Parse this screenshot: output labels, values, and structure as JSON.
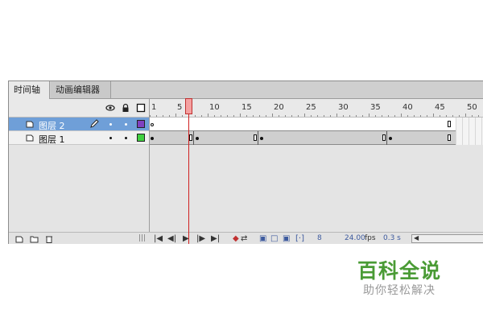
{
  "tabs": [
    {
      "label": "时间轴",
      "active": true
    },
    {
      "label": "动画编辑器",
      "active": false
    }
  ],
  "header_icons": [
    "eye-icon",
    "lock-icon",
    "outline-icon"
  ],
  "ruler": {
    "labels": [
      "1",
      "5",
      "10",
      "15",
      "20",
      "25",
      "30",
      "35",
      "40",
      "45",
      "50"
    ]
  },
  "layers": [
    {
      "name": "图层 2",
      "selected": true,
      "color": "#8040c0",
      "pencil": true
    },
    {
      "name": "图层 1",
      "selected": false,
      "color": "#40d040",
      "pencil": false
    }
  ],
  "timeline": {
    "current_frame": "8",
    "fps_value": "24.00",
    "fps_unit": "fps",
    "elapsed": "0.3 s"
  },
  "watermark": {
    "title": "百科全说",
    "subtitle": "助你轻松解决"
  },
  "colors": {
    "playhead": "#d02020",
    "selected_row": "#6f9fd8",
    "watermark_green": "#4a9b35"
  }
}
